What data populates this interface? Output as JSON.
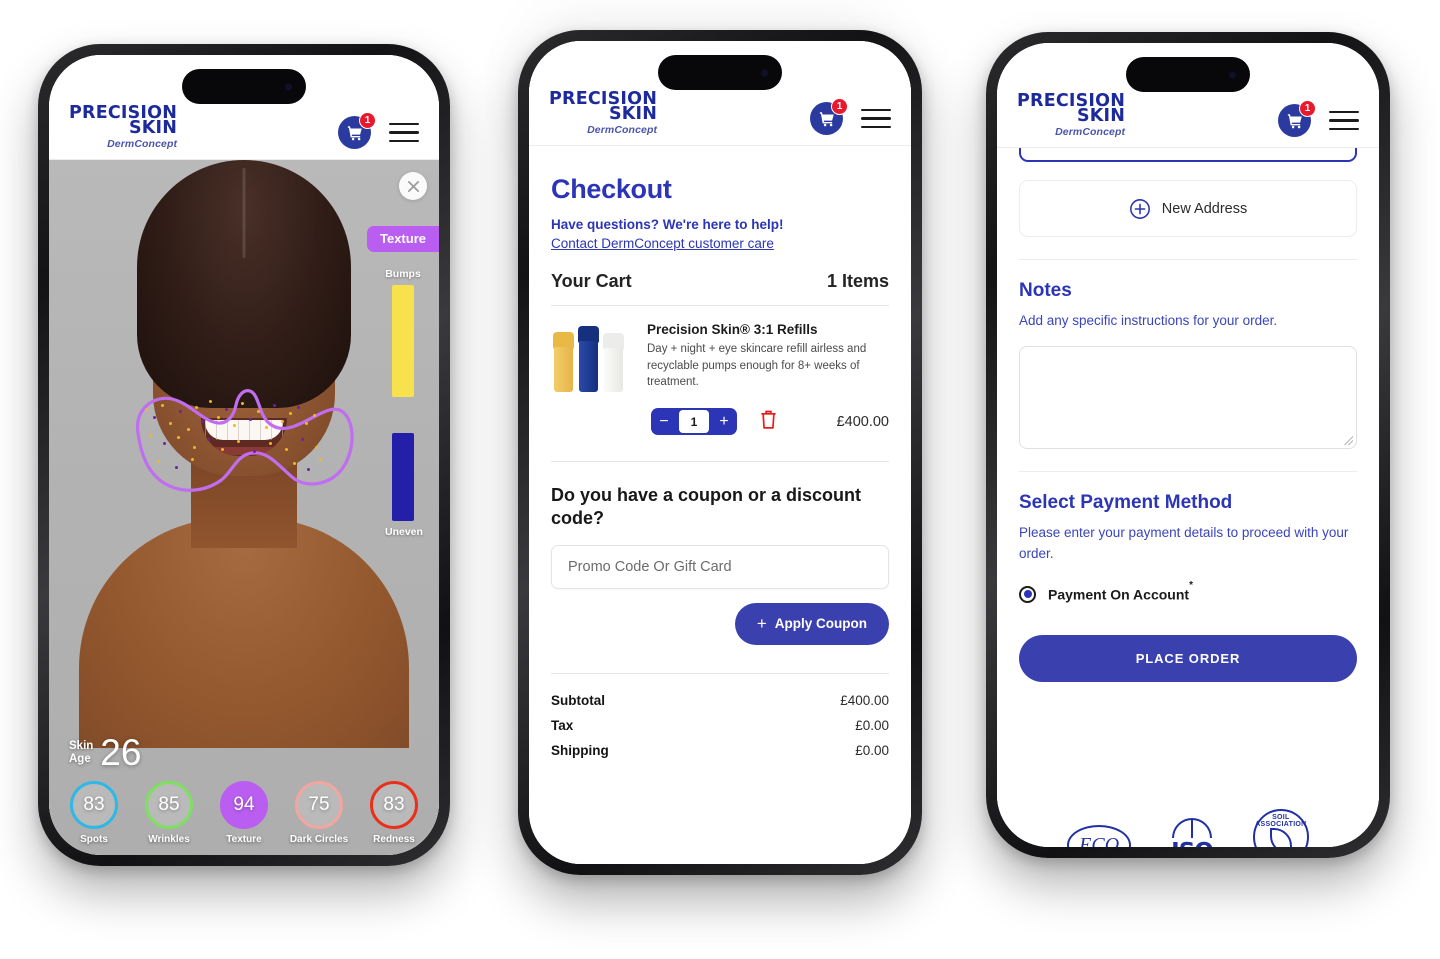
{
  "brand": {
    "logo_line1": "PRECISION",
    "logo_line2": "SKIN",
    "logo_tagline": "DermConcept",
    "primary_color": "#2b35b5",
    "accent_purple": "#b95ef0",
    "badge_red": "#e8192c"
  },
  "header": {
    "cart_icon": "shopping-cart-icon",
    "cart_badge_count": "1",
    "menu_icon": "hamburger-menu-icon"
  },
  "screen1": {
    "name": "Skin Analysis",
    "close_icon": "close-icon",
    "active_metric_pill": "Texture",
    "meters": [
      {
        "label": "Bumps",
        "color": "#f7e14c",
        "height_pct": 78
      },
      {
        "label": "Uneven",
        "color": "#241fa8",
        "height_pct": 62
      }
    ],
    "skin_age_label_line1": "Skin",
    "skin_age_label_line2": "Age",
    "skin_age_value": "26",
    "scores": [
      {
        "label": "Spots",
        "value": "83",
        "color": "#2eb8e6"
      },
      {
        "label": "Wrinkles",
        "value": "85",
        "color": "#7ee060"
      },
      {
        "label": "Texture",
        "value": "94",
        "color": "#b95ef0"
      },
      {
        "label": "Dark Circles",
        "value": "75",
        "color": "#f2a6a0"
      },
      {
        "label": "Redness",
        "value": "83",
        "color": "#e8301c"
      }
    ]
  },
  "screen2": {
    "title": "Checkout",
    "help_text": "Have questions? We're here to help!",
    "help_link": "Contact DermConcept customer care",
    "cart_title": "Your Cart",
    "cart_count": "1 Items",
    "item": {
      "name": "Precision Skin® 3:1 Refills",
      "description": "Day + night + eye skincare refill airless and recyclable pumps enough for 8+ weeks of treatment.",
      "quantity": "1",
      "decrement_label": "−",
      "increment_label": "+",
      "delete_icon": "trash-icon",
      "price": "£400.00",
      "bottle_colors": [
        "#f0c24e",
        "#1f3fa0",
        "#f2f2f0"
      ]
    },
    "coupon_question": "Do you have a coupon or a discount code?",
    "coupon_placeholder": "Promo Code Or Gift Card",
    "apply_button": "Apply Coupon",
    "totals": [
      {
        "label": "Subtotal",
        "value": "£400.00"
      },
      {
        "label": "Tax",
        "value": "£0.00"
      },
      {
        "label": "Shipping",
        "value": "£0.00"
      }
    ]
  },
  "screen3": {
    "new_address_button": "New Address",
    "new_address_icon": "plus-circle-icon",
    "notes_title": "Notes",
    "notes_subtitle": "Add any specific instructions for your order.",
    "notes_value": "",
    "payment_title": "Select Payment Method",
    "payment_subtitle": "Please enter your payment details to proceed with your order.",
    "payment_option": "Payment On Account",
    "payment_option_mark": "*",
    "place_order_button": "PLACE ORDER",
    "certifications": [
      {
        "name": "ECO",
        "label": "ECO"
      },
      {
        "name": "ISO",
        "label": "ISO"
      },
      {
        "name": "SOIL ASSOCIATION",
        "label": "SOIL ASSOCIATION"
      }
    ]
  }
}
